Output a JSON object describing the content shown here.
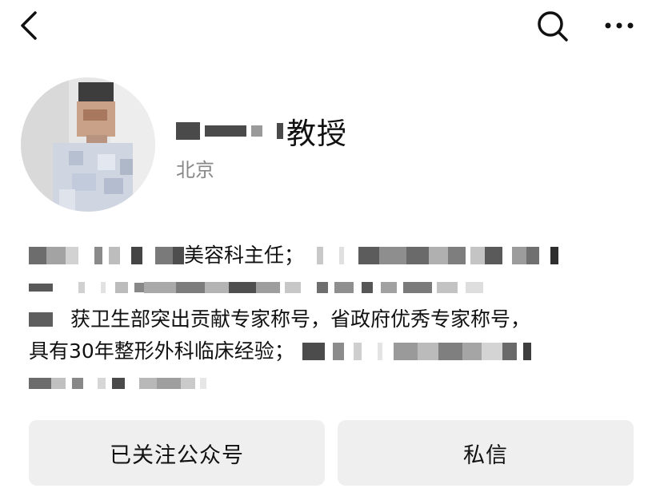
{
  "header": {
    "back_icon": "chevron-left-icon",
    "search_icon": "search-icon",
    "more_icon": "more-horizontal-icon"
  },
  "profile": {
    "name_suffix": "教授",
    "location": "北京"
  },
  "bio": {
    "line1_text": "美容科主任；",
    "line3_text": "获卫生部突出贡献专家称号，省政府优秀专家称号，",
    "line4_text": "具有30年整形外科临床经验；"
  },
  "actions": {
    "follow_label": "已关注公众号",
    "message_label": "私信"
  },
  "colors": {
    "button_bg": "#efefef",
    "secondary_text": "#888888",
    "redaction": "#4a4a4a"
  }
}
